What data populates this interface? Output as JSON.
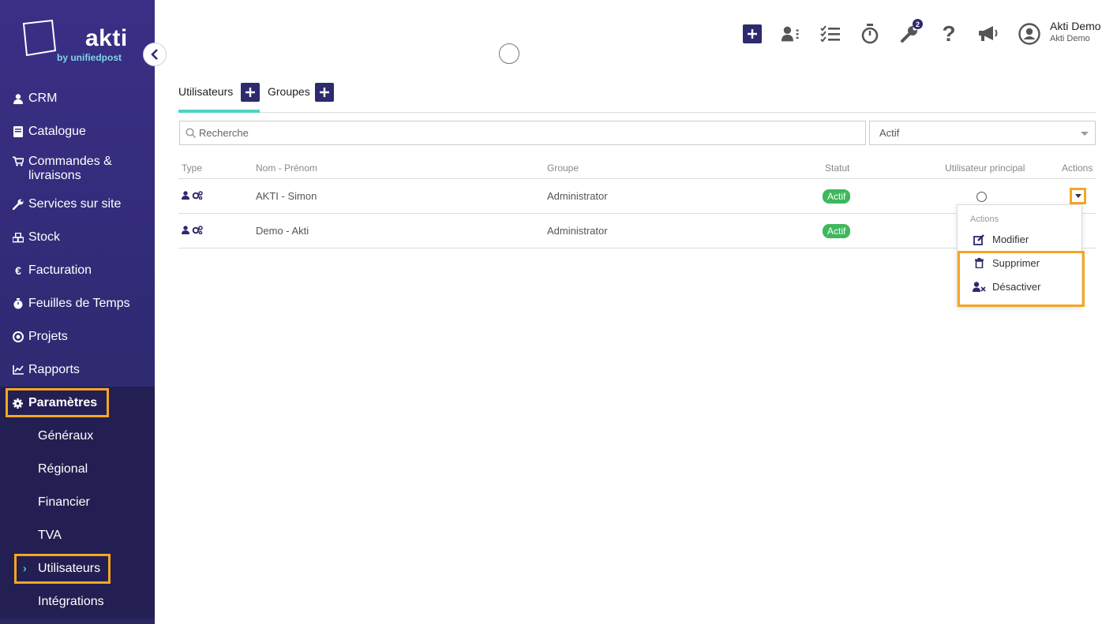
{
  "brand": {
    "name": "akti",
    "tagline": "by unifiedpost"
  },
  "sidebar": {
    "items": [
      {
        "label": "CRM",
        "icon": "user-icon"
      },
      {
        "label": "Catalogue",
        "icon": "book-icon"
      },
      {
        "label": "Commandes &",
        "label2": "livraisons",
        "icon": "cart-icon"
      },
      {
        "label": "Services sur site",
        "icon": "wrench-icon"
      },
      {
        "label": "Stock",
        "icon": "boxes-icon"
      },
      {
        "label": "Facturation",
        "icon": "euro-icon"
      },
      {
        "label": "Feuilles de Temps",
        "icon": "stopwatch-icon"
      },
      {
        "label": "Projets",
        "icon": "target-icon"
      },
      {
        "label": "Rapports",
        "icon": "chart-icon"
      }
    ],
    "active_section": {
      "label": "Paramètres",
      "icon": "gear-icon"
    },
    "subitems": [
      {
        "label": "Généraux"
      },
      {
        "label": "Régional"
      },
      {
        "label": "Financier"
      },
      {
        "label": "TVA"
      },
      {
        "label": "Utilisateurs"
      },
      {
        "label": "Intégrations"
      }
    ]
  },
  "topbar": {
    "badge_count": "2",
    "user_name": "Akti Demo",
    "user_sub": "Akti Demo"
  },
  "tabs": [
    {
      "label": "Utilisateurs"
    },
    {
      "label": "Groupes"
    }
  ],
  "search": {
    "placeholder": "Recherche"
  },
  "filter": {
    "value": "Actif"
  },
  "table": {
    "headers": [
      "Type",
      "Nom - Prénom",
      "Groupe",
      "Statut",
      "Utilisateur principal",
      "Actions"
    ],
    "rows": [
      {
        "name": "AKTI - Simon",
        "group": "Administrator",
        "status": "Actif"
      },
      {
        "name": "Demo - Akti",
        "group": "Administrator",
        "status": "Actif"
      }
    ]
  },
  "dropdown": {
    "header": "Actions",
    "items": [
      {
        "label": "Modifier",
        "icon": "edit-icon"
      },
      {
        "label": "Supprimer",
        "icon": "trash-icon"
      },
      {
        "label": "Désactiver",
        "icon": "user-x-icon"
      }
    ]
  },
  "colors": {
    "sidebar": "#3a2f86",
    "accent": "#2d2a6e",
    "teal": "#4fd1c5",
    "highlight": "#f5a623",
    "status_green": "#3db85c"
  }
}
